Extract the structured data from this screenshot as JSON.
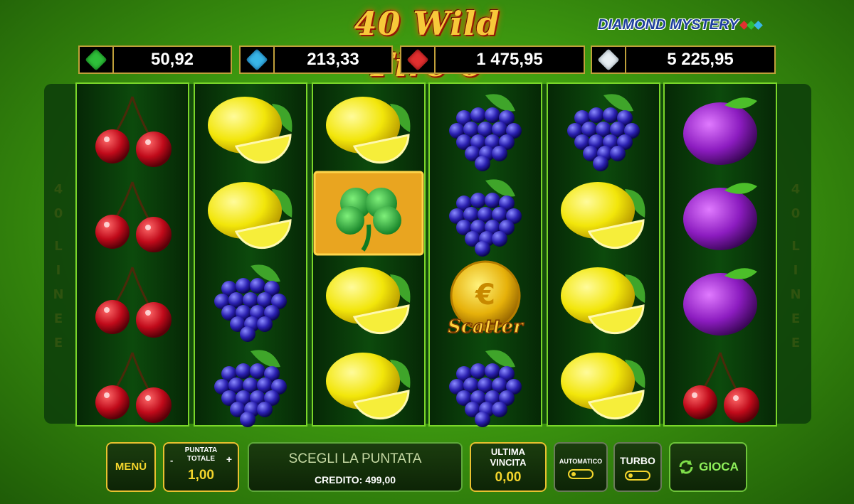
{
  "header": {
    "title": "40 Wild Fire 6",
    "brand": "DIAMOND MYSTERY"
  },
  "jackpots": [
    {
      "value": "50,92",
      "gem_color": "#2fbf3a",
      "gem_icon": "green-gem-icon"
    },
    {
      "value": "213,33",
      "gem_color": "#39b6e8",
      "gem_icon": "blue-gem-icon"
    },
    {
      "value": "1 475,95",
      "gem_color": "#e23030",
      "gem_icon": "red-gem-icon"
    },
    {
      "value": "5 225,95",
      "gem_color": "#e8eef2",
      "gem_icon": "diamond-icon"
    }
  ],
  "lines": {
    "left": [
      "4",
      "0",
      "L",
      "I",
      "N",
      "E",
      "E"
    ],
    "right": [
      "4",
      "0",
      "L",
      "I",
      "N",
      "E",
      "E"
    ]
  },
  "reels": [
    [
      "cherry",
      "cherry",
      "cherry",
      "cherry"
    ],
    [
      "lemon",
      "lemon",
      "grapes",
      "grapes"
    ],
    [
      "lemon",
      "clover",
      "lemon",
      "lemon"
    ],
    [
      "grapes",
      "grapes",
      "scatter",
      "grapes"
    ],
    [
      "grapes",
      "lemon",
      "lemon",
      "lemon"
    ],
    [
      "plum",
      "plum",
      "plum",
      "cherry"
    ]
  ],
  "symbols": {
    "scatter_label": "Scatter",
    "scatter_coin_glyph": "€"
  },
  "controls": {
    "menu_label": "MENÙ",
    "bet_title": "PUNTATA TOTALE",
    "bet_minus": "-",
    "bet_plus": "+",
    "bet_value": "1,00",
    "status_text": "SCEGLI LA PUNTATA",
    "credit_text": "CREDITO: 499,00",
    "last_win_title": "ULTIMA VINCITA",
    "last_win_value": "0,00",
    "auto_label": "AUTOMATICO",
    "turbo_label": "TURBO",
    "spin_label": "GIOCA"
  },
  "colors": {
    "accent_gold": "#f3d52c",
    "panel_dark": "#0d2406",
    "reel_border": "#7ad62a"
  }
}
